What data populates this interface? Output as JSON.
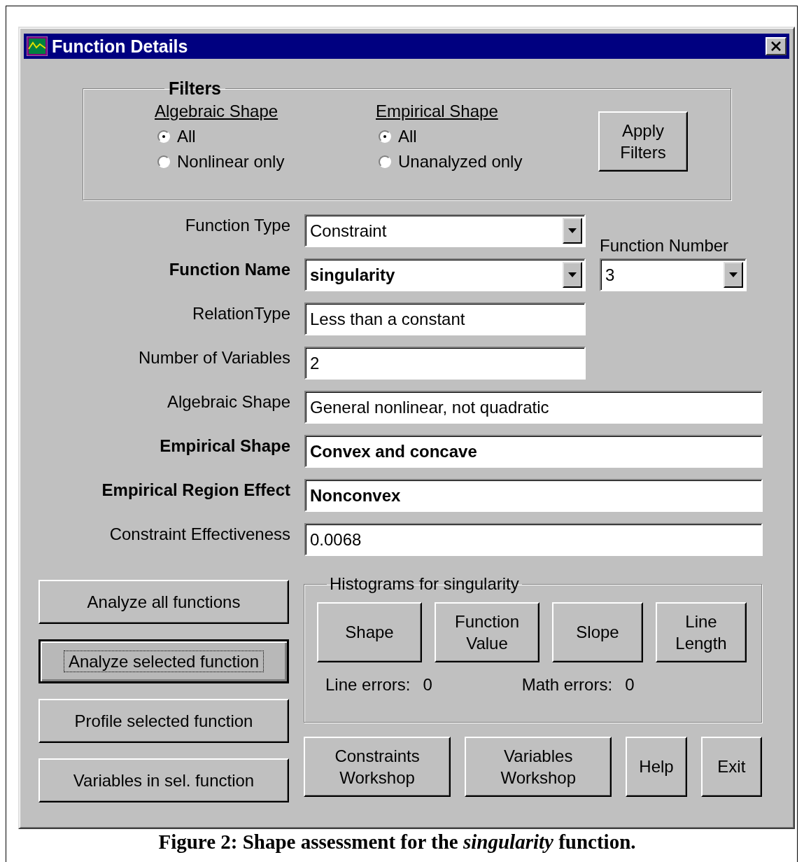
{
  "window": {
    "title": "Function Details"
  },
  "filters": {
    "title": "Filters",
    "groups": [
      {
        "heading": "Algebraic Shape",
        "options": [
          {
            "label": "All",
            "selected": true
          },
          {
            "label": "Nonlinear only",
            "selected": false
          }
        ]
      },
      {
        "heading": "Empirical Shape",
        "options": [
          {
            "label": "All",
            "selected": true
          },
          {
            "label": "Unanalyzed only",
            "selected": false
          }
        ]
      }
    ],
    "apply_button": [
      "Apply",
      "Filters"
    ]
  },
  "fields": [
    {
      "label": "Function Type",
      "kind": "dropdown",
      "value": "Constraint",
      "emphasized": false
    },
    {
      "label": "Function Name",
      "kind": "dropdown",
      "value": "singularity",
      "emphasized": true
    },
    {
      "label": "RelationType",
      "kind": "short",
      "value": "Less than a constant",
      "emphasized": false
    },
    {
      "label": "Number of Variables",
      "kind": "short",
      "value": "2",
      "emphasized": false
    },
    {
      "label": "Algebraic Shape",
      "kind": "wide",
      "value": "General nonlinear, not quadratic",
      "emphasized": false
    },
    {
      "label": "Empirical Shape",
      "kind": "wide",
      "value": "Convex and concave",
      "emphasized": true
    },
    {
      "label": "Empirical Region Effect",
      "kind": "wide",
      "value": "Nonconvex",
      "emphasized": true
    },
    {
      "label": "Constraint Effectiveness",
      "kind": "wide",
      "value": "0.0068",
      "emphasized": false
    }
  ],
  "function_number": {
    "label": "Function Number",
    "value": "3"
  },
  "analysis_buttons": [
    {
      "label": "Analyze all functions",
      "focused": false
    },
    {
      "label": "Analyze selected function",
      "focused": true
    },
    {
      "label": "Profile selected function",
      "focused": false
    },
    {
      "label": "Variables in sel. function",
      "focused": false
    }
  ],
  "histograms": {
    "title": "Histograms for singularity",
    "buttons": [
      [
        "Shape"
      ],
      [
        "Function",
        "Value"
      ],
      [
        "Slope"
      ],
      [
        "Line",
        "Length"
      ]
    ],
    "line_errors": {
      "label": "Line errors:",
      "value": "0"
    },
    "math_errors": {
      "label": "Math errors:",
      "value": "0"
    }
  },
  "footer_buttons": [
    [
      "Constraints",
      "Workshop"
    ],
    [
      "Variables",
      "Workshop"
    ],
    [
      "Help"
    ],
    [
      "Exit"
    ]
  ],
  "caption": "Figure 2: Shape assessment for the *singularity* function."
}
